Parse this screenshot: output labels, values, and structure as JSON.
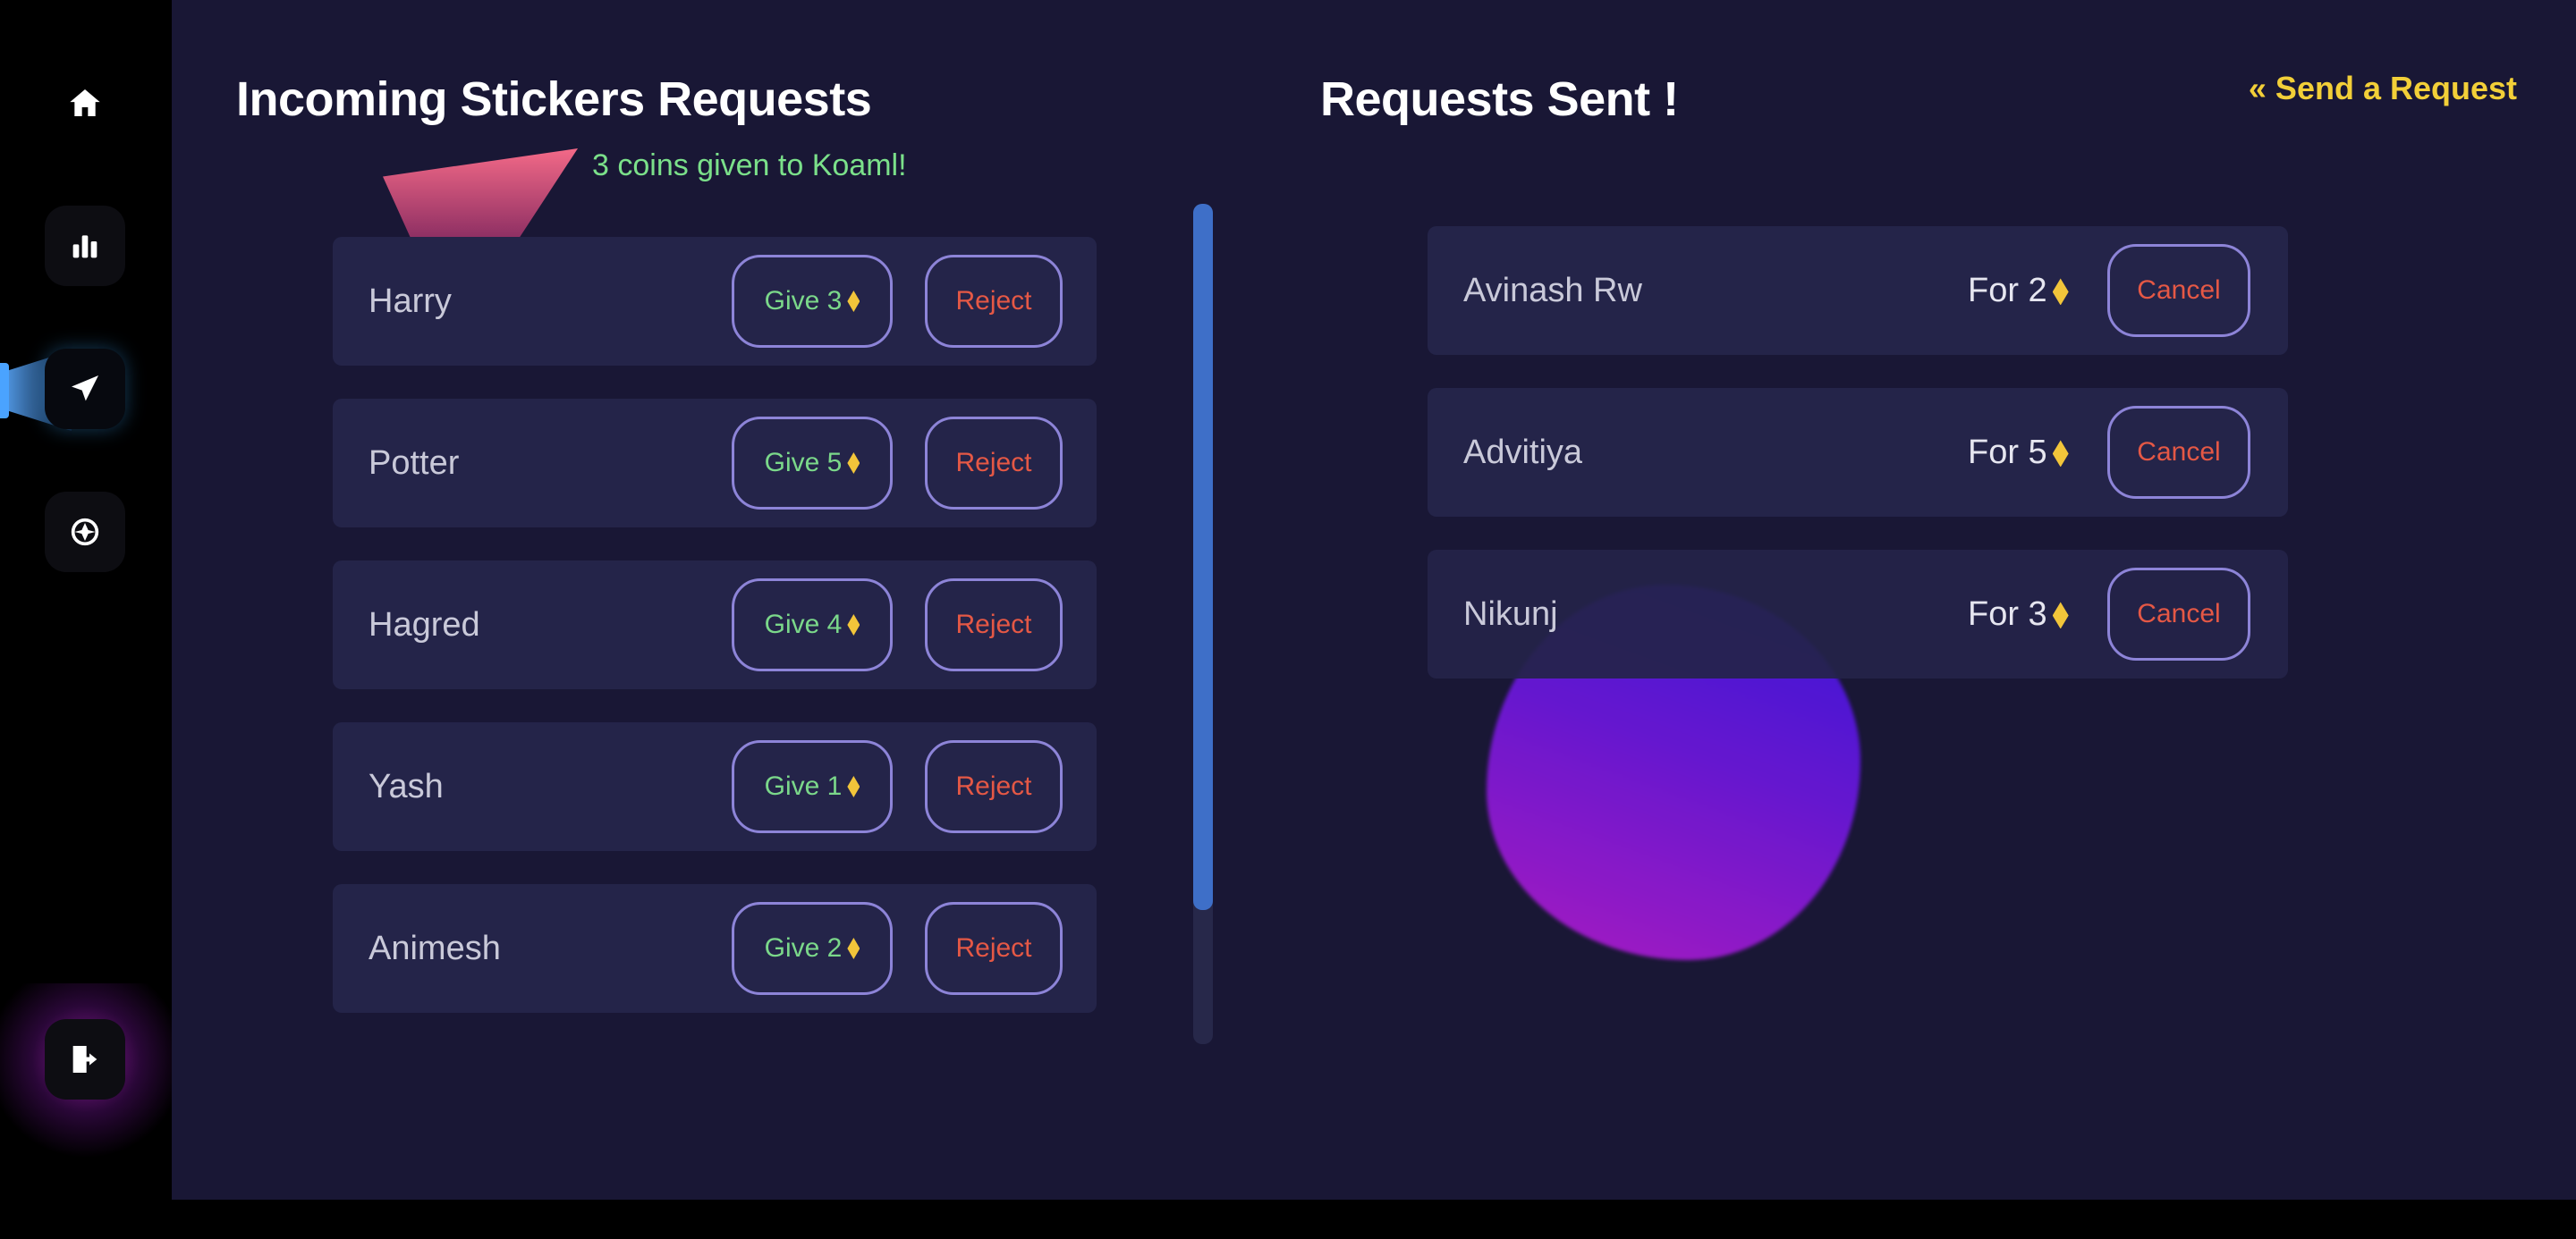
{
  "sidebar": {
    "items": [
      {
        "icon": "home-icon"
      },
      {
        "icon": "bar-chart-icon"
      },
      {
        "icon": "send-icon",
        "active": true
      },
      {
        "icon": "explore-icon"
      }
    ],
    "logout_icon": "logout-icon"
  },
  "incoming": {
    "title": "Incoming Stickers Requests",
    "toast": "3 coins given to Koaml!",
    "reject_label": "Reject",
    "requests": [
      {
        "name": "Harry",
        "give_label": "Give 3"
      },
      {
        "name": "Potter",
        "give_label": "Give 5"
      },
      {
        "name": "Hagred",
        "give_label": "Give 4"
      },
      {
        "name": "Yash",
        "give_label": "Give 1"
      },
      {
        "name": "Animesh",
        "give_label": "Give 2"
      }
    ]
  },
  "sent": {
    "title": "Requests Sent !",
    "send_link": "« Send a Request",
    "cancel_label": "Cancel",
    "requests": [
      {
        "name": "Avinash Rw",
        "for_label": "For 2"
      },
      {
        "name": "Advitiya",
        "for_label": "For 5"
      },
      {
        "name": "Nikunj",
        "for_label": "For 3"
      }
    ]
  },
  "colors": {
    "background": "#191735",
    "row": "#242449",
    "give": "#7bd88a",
    "reject": "#e55845",
    "coin": "#f2c53a",
    "link": "#f2cf38",
    "border": "#8d84d8"
  }
}
